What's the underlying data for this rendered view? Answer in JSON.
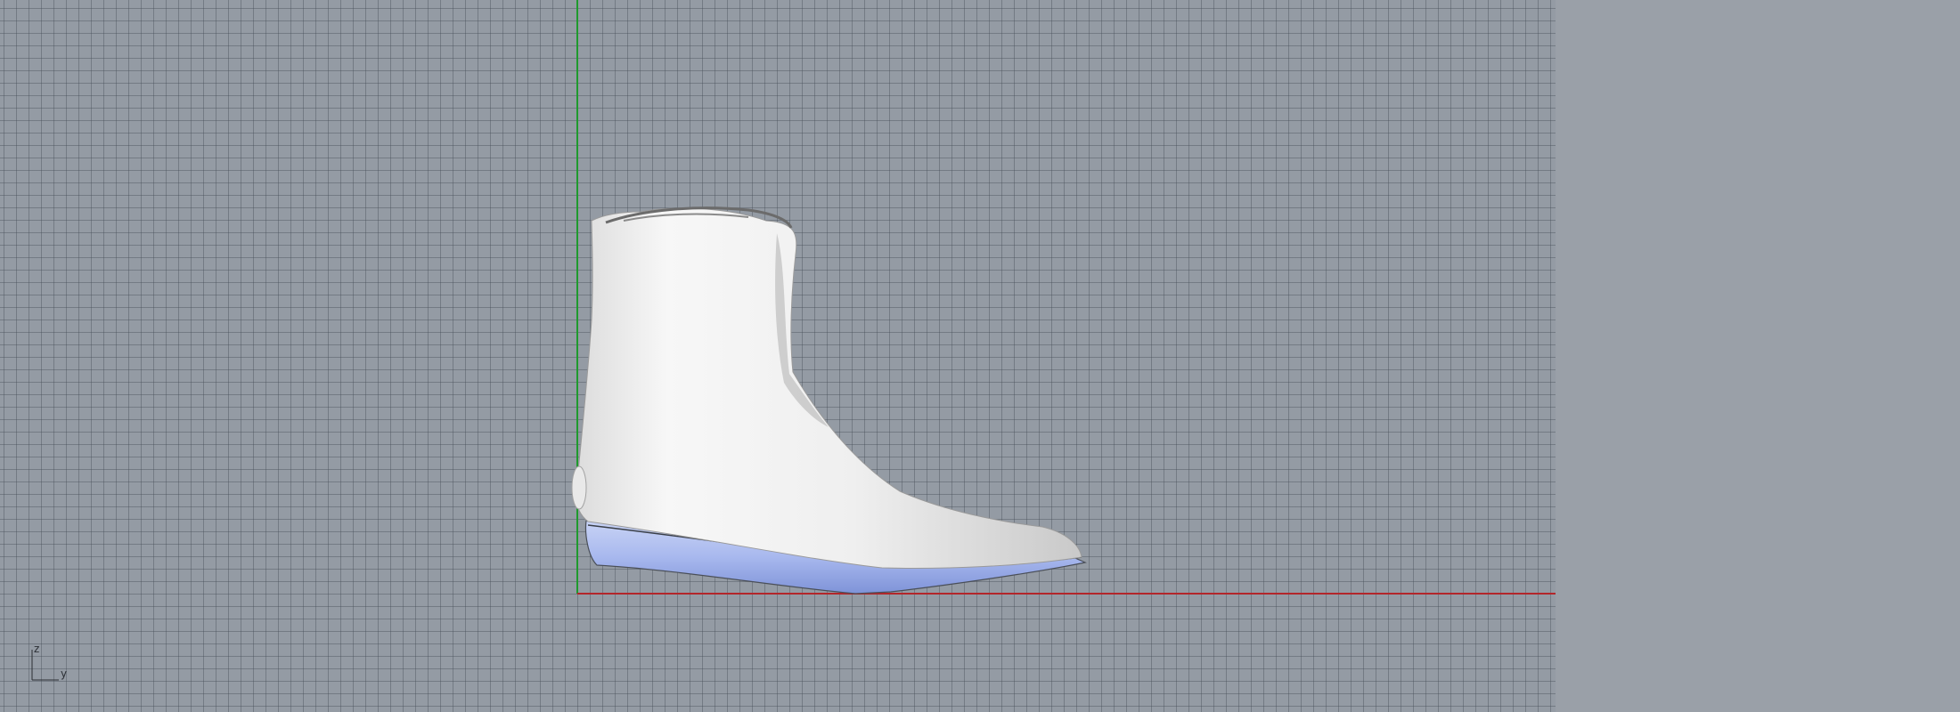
{
  "viewport": {
    "grid_color": "#4e5660",
    "background_color": "#949ba4",
    "x_axis_color": "#b3262a",
    "z_axis_color": "#1f9a2d",
    "model_color": "#f1f1f1",
    "sole_color": "#9fb3ec"
  },
  "axis_gizmo": {
    "z_label": "z",
    "y_label": "y"
  }
}
